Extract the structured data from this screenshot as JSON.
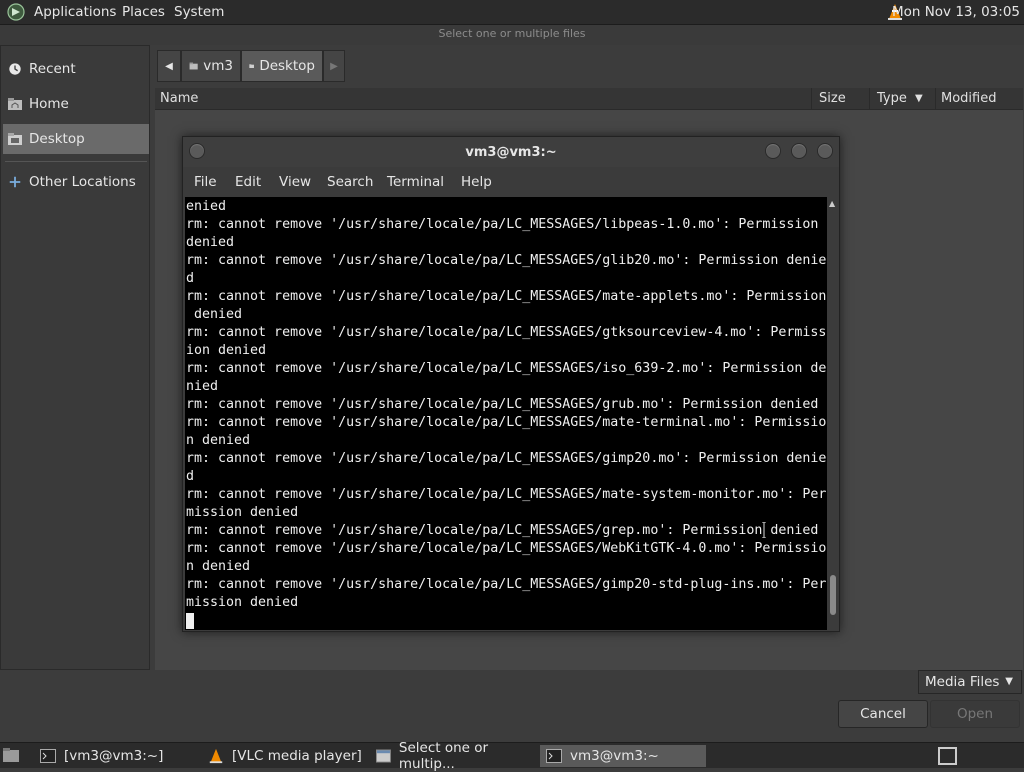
{
  "top_panel": {
    "menus": [
      "Applications",
      "Places",
      "System"
    ],
    "clock": "Mon Nov 13, 03:05"
  },
  "file_chooser": {
    "title": "Select one or multiple files",
    "places": [
      {
        "label": "Recent",
        "icon": "recent-icon"
      },
      {
        "label": "Home",
        "icon": "home-folder-icon"
      },
      {
        "label": "Desktop",
        "icon": "desktop-folder-icon",
        "selected": true
      },
      {
        "label": "Other Locations",
        "icon": "plus-icon"
      }
    ],
    "pathbar": [
      "vm3",
      "Desktop"
    ],
    "columns": [
      "Name",
      "Size",
      "Type",
      "Modified"
    ],
    "filter": "Media Files",
    "cancel_label": "Cancel",
    "open_label": "Open"
  },
  "terminal": {
    "title": "vm3@vm3:~",
    "menu": [
      "File",
      "Edit",
      "View",
      "Search",
      "Terminal",
      "Help"
    ],
    "lines": [
      "enied",
      "rm: cannot remove '/usr/share/locale/pa/LC_MESSAGES/libpeas-1.0.mo': Permission",
      "denied",
      "rm: cannot remove '/usr/share/locale/pa/LC_MESSAGES/glib20.mo': Permission denie",
      "d",
      "rm: cannot remove '/usr/share/locale/pa/LC_MESSAGES/mate-applets.mo': Permission",
      " denied",
      "rm: cannot remove '/usr/share/locale/pa/LC_MESSAGES/gtksourceview-4.mo': Permiss",
      "ion denied",
      "rm: cannot remove '/usr/share/locale/pa/LC_MESSAGES/iso_639-2.mo': Permission de",
      "nied",
      "rm: cannot remove '/usr/share/locale/pa/LC_MESSAGES/grub.mo': Permission denied",
      "rm: cannot remove '/usr/share/locale/pa/LC_MESSAGES/mate-terminal.mo': Permissio",
      "n denied",
      "rm: cannot remove '/usr/share/locale/pa/LC_MESSAGES/gimp20.mo': Permission denie",
      "d",
      "rm: cannot remove '/usr/share/locale/pa/LC_MESSAGES/mate-system-monitor.mo': Per",
      "mission denied",
      "rm: cannot remove '/usr/share/locale/pa/LC_MESSAGES/grep.mo': Permission denied",
      "rm: cannot remove '/usr/share/locale/pa/LC_MESSAGES/WebKitGTK-4.0.mo': Permissio",
      "n denied",
      "rm: cannot remove '/usr/share/locale/pa/LC_MESSAGES/gimp20-std-plug-ins.mo': Per",
      "mission denied"
    ]
  },
  "taskbar": {
    "items": [
      {
        "label": "[vm3@vm3:~]",
        "icon": "terminal-icon"
      },
      {
        "label": "[VLC media player]",
        "icon": "vlc-icon"
      },
      {
        "label": "Select one or multip...",
        "icon": "file-chooser-icon"
      },
      {
        "label": "vm3@vm3:~",
        "icon": "terminal-icon",
        "active": true
      }
    ]
  }
}
